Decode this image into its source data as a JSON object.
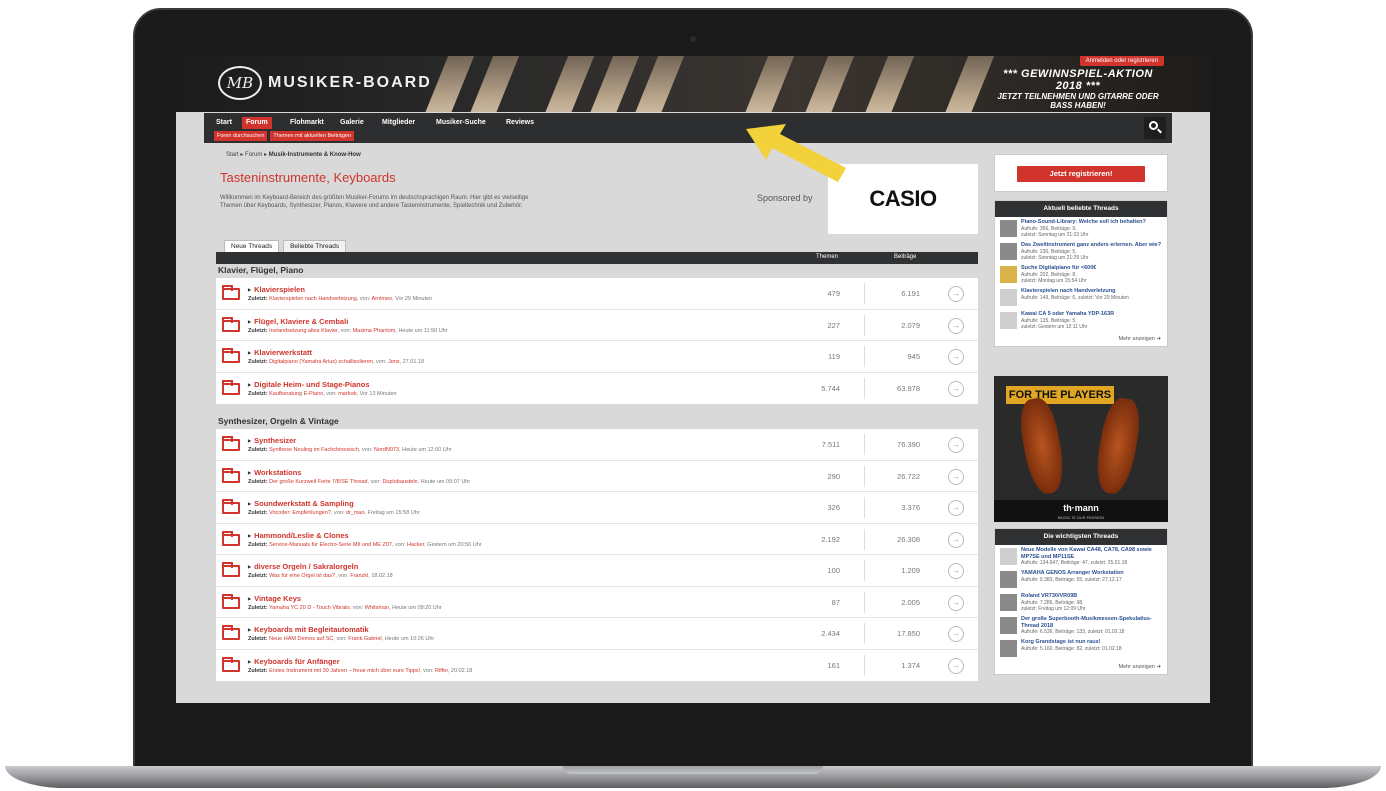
{
  "site": {
    "logo_mark": "MB",
    "logo_text": "MUSIKER-BOARD",
    "login_link": "Anmelden oder registrieren",
    "promo_line1": "*** GEWINNSPIEL-AKTION 2018 ***",
    "promo_line2": "JETZT TEILNEHMEN UND GITARRE ODER BASS HABEN!"
  },
  "nav": {
    "items": [
      "Start",
      "Forum",
      "Flohmarkt",
      "Galerie",
      "Mitglieder",
      "Musiker-Suche",
      "Reviews"
    ],
    "active": "Forum",
    "sub": [
      "Foren durchsuchen",
      "Themen mit aktuellen Beiträgen"
    ]
  },
  "breadcrumb": [
    "Start",
    "Forum",
    "Musik-Instrumente & Know-How"
  ],
  "page": {
    "title": "Tasteninstrumente, Keyboards",
    "description": "Willkommen im Keyboard-Bereich des größten Musiker-Forums im deutschsprachigen Raum. Hier gibt es vielseitige Themen über Keyboards, Synthesizer, Pianos, Klaviere und andere Tasteninstrumente, Spieltechnik und Zubehör.",
    "sponsored_by": "Sponsored by",
    "sponsor_logo": "CASIO",
    "tabs": [
      "Neue Threads",
      "Beliebte Threads"
    ],
    "col_themen": "Themen",
    "col_beitraege": "Beiträge"
  },
  "categories": [
    {
      "name": "Klavier, Flügel, Piano",
      "forums": [
        {
          "title": "Klavierspielen",
          "prefix": "Zuletzt:",
          "last_thread": "Klavierspielen nach Handverletzung",
          "by_label": "von:",
          "user": "Arnimeo",
          "time": "Vor 29 Minuten",
          "themen": "479",
          "beitraege": "6.191"
        },
        {
          "title": "Flügel, Klaviere & Cembali",
          "prefix": "Zuletzt:",
          "last_thread": "Instandsetzung altes Klavier",
          "by_label": "von:",
          "user": "Maxima Phantom",
          "time": "Heute um 11:50 Uhr",
          "themen": "227",
          "beitraege": "2.079"
        },
        {
          "title": "Klavierwerkstatt",
          "prefix": "Zuletzt:",
          "last_thread": "Digitalpiano (Yamaha Arius) schallisolieren",
          "by_label": "von:",
          "user": "Jens",
          "time": "27.01.18",
          "themen": "119",
          "beitraege": "945"
        },
        {
          "title": "Digitale Heim- und Stage-Pianos",
          "prefix": "Zuletzt:",
          "last_thread": "Kaufberatung E-Piano",
          "by_label": "von:",
          "user": "markob",
          "time": "Vor 13 Minuten",
          "themen": "5.744",
          "beitraege": "63.978"
        }
      ]
    },
    {
      "name": "Synthesizer, Orgeln & Vintage",
      "forums": [
        {
          "title": "Synthesizer",
          "prefix": "Zuletzt:",
          "last_thread": "Synthese Neuling im Fachchinesisch",
          "by_label": "von:",
          "user": "NordN073",
          "time": "Heute um 12:00 Uhr",
          "themen": "7.511",
          "beitraege": "76.390"
        },
        {
          "title": "Workstations",
          "prefix": "Zuletzt:",
          "last_thread": "Der große Kurzweil Forte 7/8/SE Thread",
          "by_label": "von:",
          "user": "Duplobausteln",
          "time": "Heute um 09:07 Uhr",
          "themen": "290",
          "beitraege": "26.722"
        },
        {
          "title": "Soundwerkstatt & Sampling",
          "prefix": "Zuletzt:",
          "last_thread": "Vocoder: Empfehlungen?",
          "by_label": "von:",
          "user": "dr_mao",
          "time": "Freitag um 15:58 Uhr",
          "themen": "326",
          "beitraege": "3.376"
        },
        {
          "title": "Hammond/Leslie & Clones",
          "prefix": "Zuletzt:",
          "last_thread": "Service-Manuals für Electro-Serie MII und ME Z07",
          "by_label": "von:",
          "user": "Hacker",
          "time": "Gestern um 20:56 Uhr",
          "themen": "2.192",
          "beitraege": "26.308"
        },
        {
          "title": "diverse Orgeln / Sakralorgeln",
          "prefix": "Zuletzt:",
          "last_thread": "Was für eine Orgel ist das?",
          "by_label": "von:",
          "user": "Franzkl",
          "time": "18.02.18",
          "themen": "100",
          "beitraege": "1.209"
        },
        {
          "title": "Vintage Keys",
          "prefix": "Zuletzt:",
          "last_thread": "Yamaha YC 20 D - Touch Vibrato",
          "by_label": "von:",
          "user": "Whitsman",
          "time": "Heute um 08:20 Uhr",
          "themen": "87",
          "beitraege": "2.005"
        },
        {
          "title": "Keyboards mit Begleitautomatik",
          "prefix": "Zuletzt:",
          "last_thread": "Neue HAM Demos auf SC",
          "by_label": "von:",
          "user": "Frank Gabriel",
          "time": "Heute um 10:26 Uhr",
          "themen": "2.434",
          "beitraege": "17.850"
        },
        {
          "title": "Keyboards für Anfänger",
          "prefix": "Zuletzt:",
          "last_thread": "Erstes Instrument mit 30 Jahren – freue mich über eure Tipps!",
          "by_label": "von:",
          "user": "Riffer",
          "time": "20.02.18",
          "themen": "161",
          "beitraege": "1.374"
        }
      ]
    }
  ],
  "sidebar": {
    "register_button": "Jetzt registrieren!",
    "popular": {
      "title": "Aktuell beliebte Threads",
      "items": [
        {
          "title": "Piano-Sound-Library: Welche soll ich behalten?",
          "meta1": "Aufrufe: 356, Beiträge: 9,",
          "meta2": "zuletzt: Sonntag um 21:33 Uhr"
        },
        {
          "title": "Das Zweitinstrument ganz anders erlernen. Aber wie?",
          "meta1": "Aufrufe: 230, Beiträge: 5,",
          "meta2": "zuletzt: Sonntag um 21:29 Uhr"
        },
        {
          "title": "Suche Digitalpiano für <600€",
          "meta1": "Aufrufe: 202, Beiträge: 8,",
          "meta2": "zuletzt: Montag um 15:54 Uhr"
        },
        {
          "title": "Klavierspielen nach Handverletzung",
          "meta1": "Aufrufe: 149, Beiträge: 6, zuletzt: Vor 29 Minuten",
          "meta2": ""
        },
        {
          "title": "Kawai CA 5 oder Yamaha YDP-163R",
          "meta1": "Aufrufe: 135, Beiträge: 5,",
          "meta2": "zuletzt: Gestern um 12:11 Uhr"
        }
      ],
      "more": "Mehr anzeigen"
    },
    "ad": {
      "banner": "FOR THE PLAYERS",
      "brand": "th·mann",
      "tagline": "MUSIC IS OUR PASSION"
    },
    "important": {
      "title": "Die wichtigsten Threads",
      "items": [
        {
          "title": "Neue Modelle von Kawai CA48, CA78, CA98 sowie MP7SE und MP11SE",
          "meta1": "Aufrufe: 134.647, Beiträge: 47, zuletzt: 25.01.18",
          "meta2": ""
        },
        {
          "title": "YAMAHA GENOS Arranger Workstation",
          "meta1": "Aufrufe: 9.383, Beiträge: 55, zuletzt: 27.12.17",
          "meta2": ""
        },
        {
          "title": "Roland VR730/VR09B",
          "meta1": "Aufrufe: 7.286, Beiträge: 98,",
          "meta2": "zuletzt: Freitag um 12:09 Uhr"
        },
        {
          "title": "Der große Superbooth-Musikmessen-Spekulatius-Thread 2018",
          "meta1": "Aufrufe: 6.536, Beiträge: 133, zuletzt: 01.02.18",
          "meta2": ""
        },
        {
          "title": "Korg Grandstage ist nun raus!",
          "meta1": "Aufrufe: 5.160, Beiträge: 82, zuletzt: 01.02.18",
          "meta2": ""
        }
      ],
      "more": "Mehr anzeigen"
    }
  },
  "colors": {
    "accent": "#d0342c",
    "nav_bg": "#2c2e30",
    "arrow": "#f2d13a"
  }
}
